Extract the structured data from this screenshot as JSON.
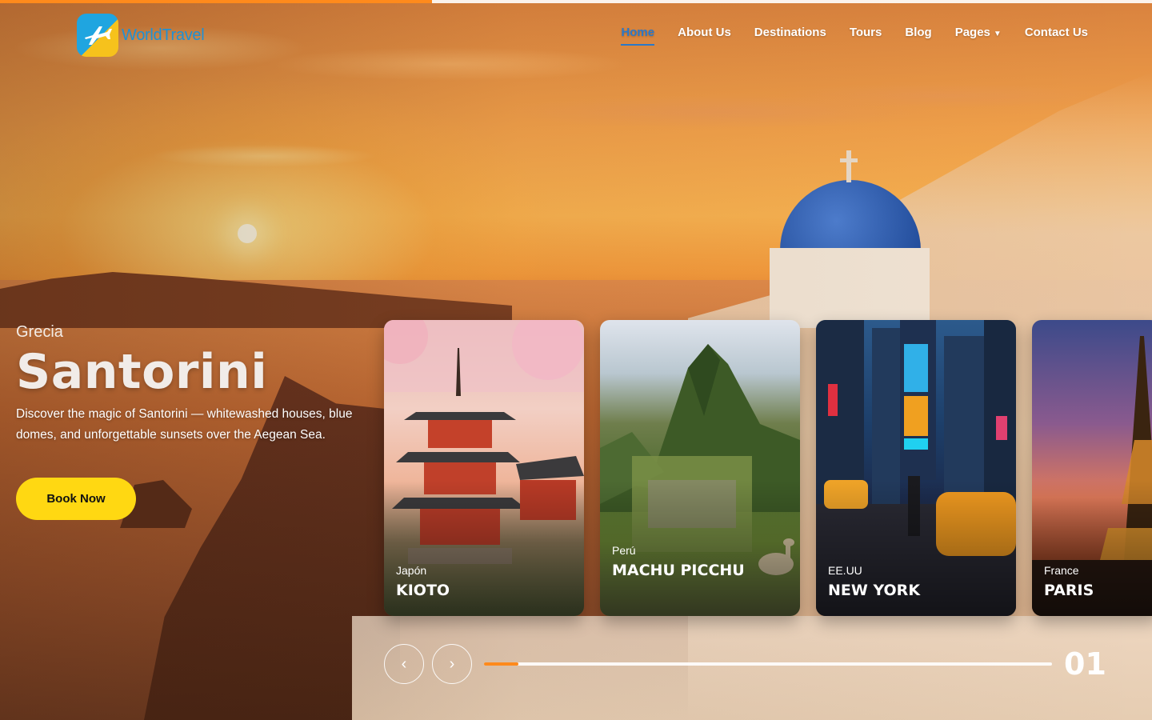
{
  "brand": {
    "name": "WorldTravel",
    "colors": {
      "primary_blue": "#1fa5e0",
      "accent_yellow": "#ffd812",
      "accent_orange": "#ff8a1c"
    }
  },
  "nav": {
    "items": [
      {
        "label": "Home",
        "active": true
      },
      {
        "label": "About Us",
        "active": false
      },
      {
        "label": "Destinations",
        "active": false
      },
      {
        "label": "Tours",
        "active": false
      },
      {
        "label": "Blog",
        "active": false
      },
      {
        "label": "Pages",
        "active": false,
        "has_dropdown": true
      },
      {
        "label": "Contact Us",
        "active": false
      }
    ],
    "dropdown_icon": "caret-down-icon"
  },
  "hero": {
    "country": "Grecia",
    "title": "Santorini",
    "description": "Discover the magic of Santorini — whitewashed houses, blue domes, and unforgettable sunsets over the Aegean Sea.",
    "cta_label": "Book Now"
  },
  "cards": [
    {
      "country": "Japón",
      "city": "KIOTO"
    },
    {
      "country": "Perú",
      "city": "MACHU PICCHU"
    },
    {
      "country": "EE.UU",
      "city": "NEW YORK"
    },
    {
      "country": "France",
      "city": "PARIS"
    }
  ],
  "slider": {
    "prev_icon": "chevron-left-icon",
    "next_icon": "chevron-right-icon",
    "current_slide": "01",
    "progress_fraction": 0.06
  },
  "page_load_progress_fraction": 0.375
}
